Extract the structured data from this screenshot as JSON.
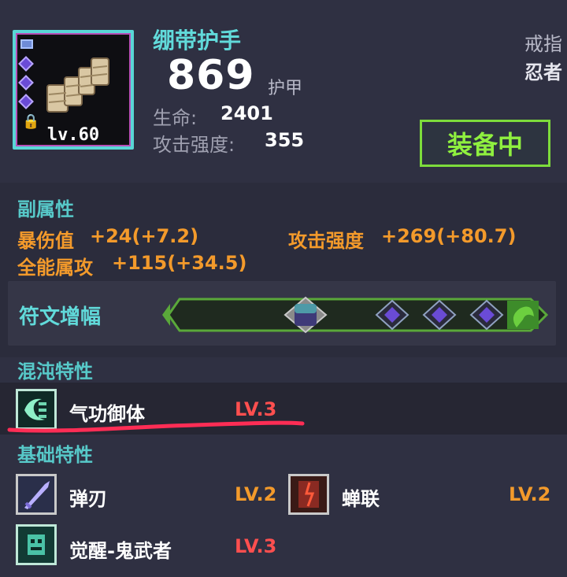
{
  "item": {
    "name": "绷带护手",
    "armor_value": "869",
    "armor_label": "护甲",
    "level": "lv.60",
    "slot_type": "戒指",
    "class_name": "忍者",
    "equip_status": "装备中",
    "stats": [
      {
        "label": "生命:",
        "value": "2401"
      },
      {
        "label": "攻击强度:",
        "value": "355"
      }
    ]
  },
  "sub_attributes": {
    "title": "副属性",
    "entries": [
      {
        "label": "暴伤值",
        "value": "+24(+7.2)"
      },
      {
        "label": "攻击强度",
        "value": "+269(+80.7)"
      },
      {
        "label": "全能属攻",
        "value": "+115(+34.5)"
      }
    ]
  },
  "rune": {
    "label": "符文增幅"
  },
  "chaos_traits": {
    "title": "混沌特性",
    "items": [
      {
        "name": "气功御体",
        "level": "LV.3",
        "icon": "chaos-qigong-icon"
      }
    ]
  },
  "basic_traits": {
    "title": "基础特性",
    "items": [
      {
        "name": "弹刃",
        "level": "LV.2",
        "icon": "spring-blade-icon"
      },
      {
        "name": "蝉联",
        "level": "LV.2",
        "icon": "cicada-chain-icon"
      },
      {
        "name": "觉醒-鬼武者",
        "level": "LV.3",
        "icon": "ghost-warrior-icon"
      }
    ]
  },
  "colors": {
    "teal": "#57c9c9",
    "orange": "#f39a2b",
    "red_level": "#ff4f4f",
    "equip_green": "#8ff03f",
    "underline_red": "#ff2d55"
  }
}
